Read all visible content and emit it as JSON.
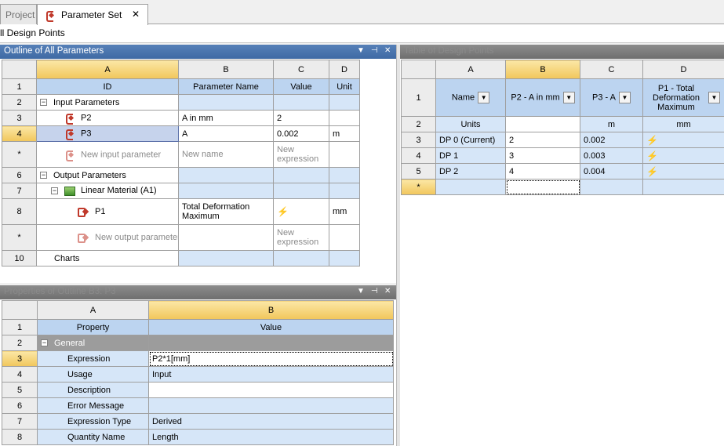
{
  "tabs": {
    "project": "Project",
    "parameter_set": "Parameter Set",
    "close": "✕"
  },
  "toolbar": {
    "label": "ll Design Points"
  },
  "outline": {
    "title": "Outline of All Parameters",
    "controls": [
      "▼",
      "⊣",
      "✕"
    ],
    "columns": [
      "A",
      "B",
      "C",
      "D"
    ],
    "header": {
      "id": "ID",
      "name": "Parameter Name",
      "value": "Value",
      "unit": "Unit"
    },
    "input_params": "Input Parameters",
    "p2": {
      "id": "P2",
      "name": "A in mm",
      "value": "2",
      "unit": ""
    },
    "p3": {
      "id": "P3",
      "name": "A",
      "value": "0.002",
      "unit": "m"
    },
    "new_input": {
      "id": "New input parameter",
      "name": "New name",
      "value": "New expression"
    },
    "output_params": "Output Parameters",
    "material": "Linear Material (A1)",
    "p1": {
      "id": "P1",
      "name": "Total Deformation Maximum",
      "unit": "mm"
    },
    "new_output": {
      "id": "New output parameter",
      "value": "New expression"
    },
    "charts": "Charts",
    "rows": [
      "1",
      "2",
      "3",
      "4",
      "*",
      "6",
      "7",
      "8",
      "*",
      "10"
    ]
  },
  "props": {
    "title": "Properties of Outline B3: P3",
    "controls": [
      "▼",
      "⊣",
      "✕"
    ],
    "columns": [
      "A",
      "B"
    ],
    "header": {
      "property": "Property",
      "value": "Value"
    },
    "general": "General",
    "rows": [
      "1",
      "2",
      "3",
      "4",
      "5",
      "6",
      "7",
      "8"
    ],
    "items": [
      {
        "property": "Expression",
        "value": "P2*1[mm]"
      },
      {
        "property": "Usage",
        "value": "Input"
      },
      {
        "property": "Description",
        "value": ""
      },
      {
        "property": "Error Message",
        "value": ""
      },
      {
        "property": "Expression Type",
        "value": "Derived"
      },
      {
        "property": "Quantity Name",
        "value": "Length"
      }
    ]
  },
  "dp": {
    "title": "Table of Design Points",
    "columns": [
      "A",
      "B",
      "C",
      "D"
    ],
    "header": {
      "name": "Name",
      "p2": "P2 - A in mm",
      "p3": "P3 - A",
      "p1": "P1 - Total Deformation Maximum"
    },
    "units": {
      "label": "Units",
      "p3": "m",
      "p1": "mm"
    },
    "rows": [
      "1",
      "2",
      "3",
      "4",
      "5",
      "*"
    ],
    "points": [
      {
        "name": "DP 0 (Current)",
        "p2": "2",
        "p3": "0.002"
      },
      {
        "name": "DP 1",
        "p2": "3",
        "p3": "0.003"
      },
      {
        "name": "DP 2",
        "p2": "4",
        "p3": "0.004"
      }
    ]
  }
}
